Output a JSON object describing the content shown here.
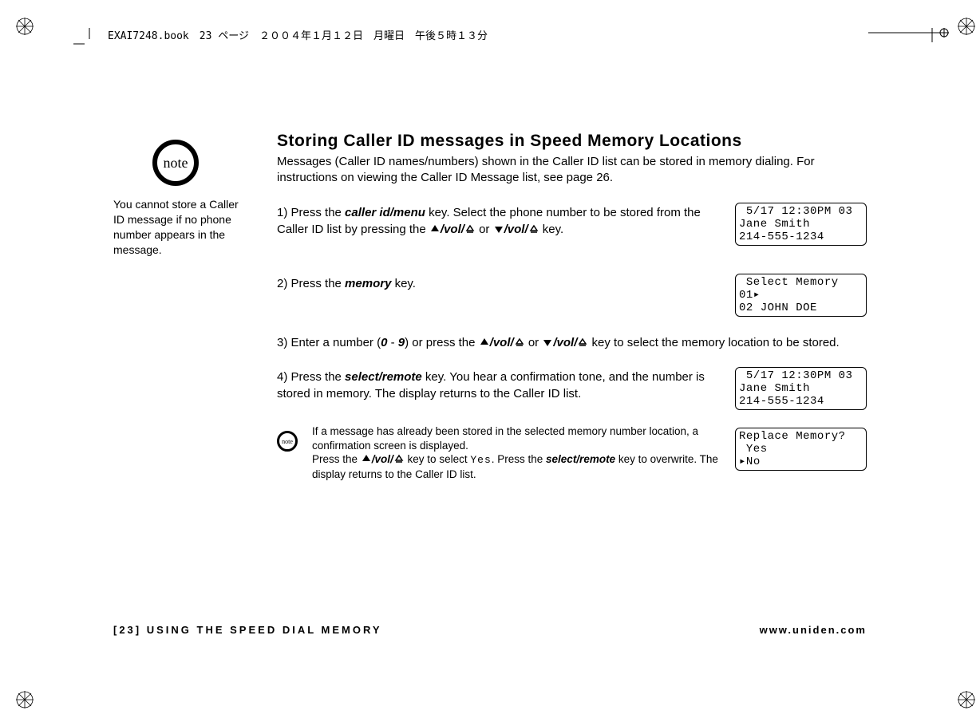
{
  "header_info": "EXAI7248.book　23 ページ　２００４年１月１２日　月曜日　午後５時１３分",
  "note_label": "note",
  "sidenote": "You cannot store a Caller ID message if no phone number appears in the message.",
  "title": "Storing Caller ID messages in Speed Memory Locations",
  "intro": "Messages (Caller ID names/numbers) shown in the Caller ID list can be stored in memory dialing. For instructions on viewing the Caller ID Message list, see page 26.",
  "step1": {
    "num": "1) ",
    "a": "Press the ",
    "k1": "caller id/menu",
    "b": " key. Select the phone number to be stored from the Caller ID list by pressing the ",
    "vol": "/vol/",
    "or": " or ",
    "vol2": "/vol/",
    "c": " key.",
    "lcd": " 5/17 12:30PM 03\nJane Smith\n214-555-1234"
  },
  "step2": {
    "num": "2) ",
    "a": "Press the ",
    "k1": "memory",
    "b": " key.",
    "lcd": " Select Memory\n01▸\n02 JOHN DOE"
  },
  "step3": {
    "num": "3) ",
    "a": "Enter a number (",
    "r1": "0",
    "dash": " - ",
    "r2": "9",
    "b": ") or press the ",
    "vol": "/vol/",
    "or": " or ",
    "vol2": "/vol/",
    "c": " key to select the memory location to be stored."
  },
  "step4": {
    "num": "4) ",
    "a": "Press the ",
    "k1": "select/remote",
    "b": " key. You hear a confirmation tone, and the number is stored in memory. The display returns to the Caller ID list.",
    "lcd": " 5/17 12:30PM 03\nJane Smith\n214-555-1234"
  },
  "subnote": {
    "a": "If a message has already been stored in the selected memory number location, a confirmation screen is displayed.",
    "b1": "Press the ",
    "vol": "/vol/",
    "b2": " key to select ",
    "yes": "Yes",
    "b3": ". Press the ",
    "k1": "select/remote",
    "b4": " key to overwrite. The display returns to the Caller ID list.",
    "lcd": "Replace Memory?\n Yes\n▸No"
  },
  "footer": {
    "left_page": "[23]",
    "left_text": " USING THE SPEED DIAL MEMORY",
    "right": "www.uniden.com"
  }
}
